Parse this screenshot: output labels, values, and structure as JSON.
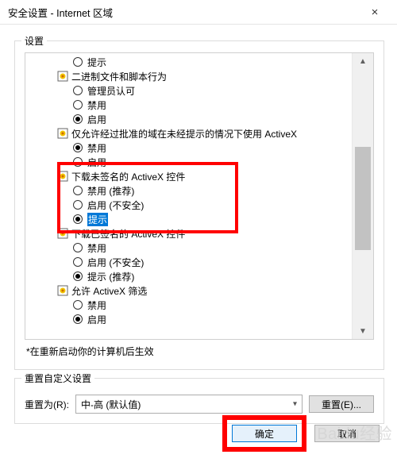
{
  "window": {
    "title": "安全设置 - Internet 区域",
    "close_glyph": "×"
  },
  "settings": {
    "group_label": "设置",
    "note": "*在重新启动你的计算机后生效",
    "tree": {
      "g0_opt0": "提示",
      "g1_label": "二进制文件和脚本行为",
      "g1_opt0": "管理员认可",
      "g1_opt1": "禁用",
      "g1_opt2": "启用",
      "g2_label": "仅允许经过批准的域在未经提示的情况下使用 ActiveX",
      "g2_opt0": "禁用",
      "g2_opt1": "启用",
      "g3_label": "下载未签名的 ActiveX 控件",
      "g3_opt0": "禁用 (推荐)",
      "g3_opt1": "启用 (不安全)",
      "g3_opt2": "提示",
      "g4_label": "下载已签名的 ActiveX 控件",
      "g4_opt0": "禁用",
      "g4_opt1": "启用 (不安全)",
      "g4_opt2": "提示 (推荐)",
      "g5_label": "允许 ActiveX 筛选",
      "g5_opt0": "禁用",
      "g5_opt1": "启用"
    }
  },
  "reset": {
    "group_label": "重置自定义设置",
    "label": "重置为(R):",
    "value": "中-高 (默认值)",
    "button": "重置(E)..."
  },
  "footer": {
    "ok": "确定",
    "cancel": "取消"
  },
  "watermark": "Baidu经验"
}
